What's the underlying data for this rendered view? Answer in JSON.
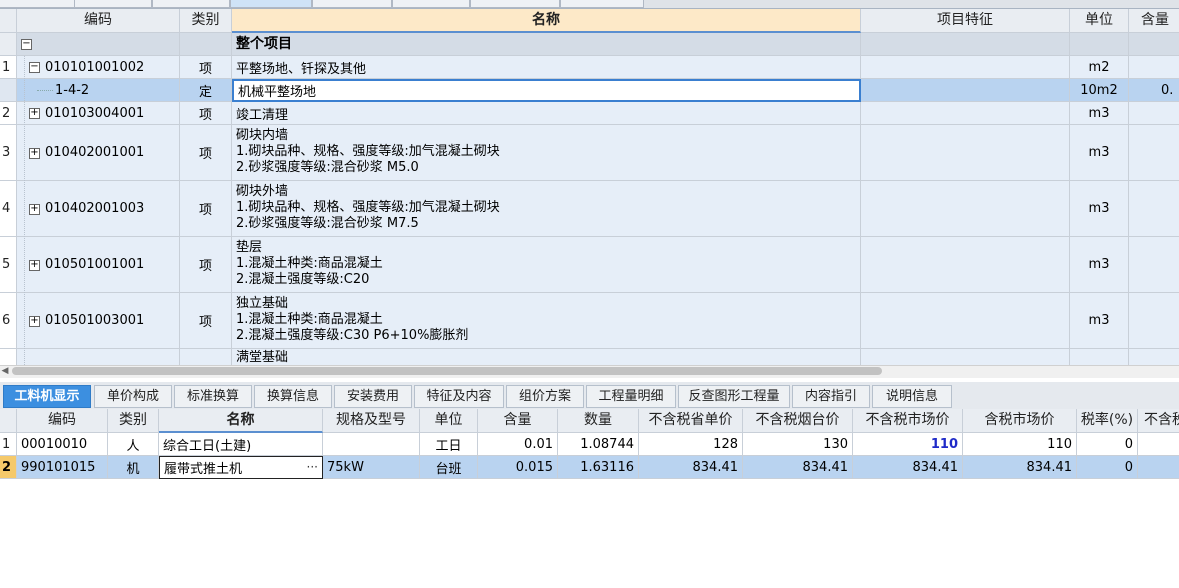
{
  "upper": {
    "headers": {
      "code": "编码",
      "type": "类别",
      "name": "名称",
      "feature": "项目特征",
      "unit": "单位",
      "content": "含量"
    },
    "section": {
      "expander": "−",
      "name": "整个项目"
    },
    "rows": [
      {
        "num": "1",
        "expander": "−",
        "code": "010101001002",
        "type": "项",
        "name_lines": [
          "平整场地、钎探及其他"
        ],
        "unit": "m2",
        "content": ""
      },
      {
        "num": "",
        "expander": "",
        "code": "1-4-2",
        "type": "定",
        "name_lines": [
          "机械平整场地"
        ],
        "unit": "10m2",
        "content": "0."
      },
      {
        "num": "2",
        "expander": "+",
        "code": "010103004001",
        "type": "项",
        "name_lines": [
          "竣工清理"
        ],
        "unit": "m3",
        "content": ""
      },
      {
        "num": "3",
        "expander": "+",
        "code": "010402001001",
        "type": "项",
        "name_lines": [
          "砌块内墙",
          "1.砌块品种、规格、强度等级:加气混凝土砌块",
          "2.砂浆强度等级:混合砂浆 M5.0"
        ],
        "unit": "m3",
        "content": ""
      },
      {
        "num": "4",
        "expander": "+",
        "code": "010402001003",
        "type": "项",
        "name_lines": [
          "砌块外墙",
          "1.砌块品种、规格、强度等级:加气混凝土砌块",
          "2.砂浆强度等级:混合砂浆 M7.5"
        ],
        "unit": "m3",
        "content": ""
      },
      {
        "num": "5",
        "expander": "+",
        "code": "010501001001",
        "type": "项",
        "name_lines": [
          "垫层",
          "1.混凝土种类:商品混凝土",
          "2.混凝土强度等级:C20"
        ],
        "unit": "m3",
        "content": ""
      },
      {
        "num": "6",
        "expander": "+",
        "code": "010501003001",
        "type": "项",
        "name_lines": [
          "独立基础",
          "1.混凝土种类:商品混凝土",
          "2.混凝土强度等级:C30 P6+10%膨胀剂"
        ],
        "unit": "m3",
        "content": ""
      },
      {
        "num": "",
        "expander": "",
        "code": "",
        "type": "",
        "name_lines": [
          "满堂基础"
        ],
        "unit": "",
        "content": ""
      }
    ]
  },
  "scroll": {
    "left_arrow": "◀"
  },
  "bottom_tabs": [
    "工料机显示",
    "单价构成",
    "标准换算",
    "换算信息",
    "安装费用",
    "特征及内容",
    "组价方案",
    "工程量明细",
    "反查图形工程量",
    "内容指引",
    "说明信息"
  ],
  "lower": {
    "headers": [
      "编码",
      "类别",
      "名称",
      "规格及型号",
      "单位",
      "含量",
      "数量",
      "不含税省单价",
      "不含税烟台价",
      "不含税市场价",
      "含税市场价",
      "税率(%)",
      "不含税"
    ],
    "rows": [
      {
        "num": "1",
        "code": "00010010",
        "type": "人",
        "name": "综合工日(土建)",
        "spec": "",
        "unit": "工日",
        "qty_rate": "0.01",
        "quantity": "1.08744",
        "prov_price": "128",
        "yantai_price": "130",
        "market_price": "110",
        "market_tax_price": "110",
        "tax_rate": "0"
      },
      {
        "num": "2",
        "code": "990101015",
        "type": "机",
        "name": "履带式推土机",
        "spec": "75kW",
        "unit": "台班",
        "qty_rate": "0.015",
        "quantity": "1.63116",
        "prov_price": "834.41",
        "yantai_price": "834.41",
        "market_price": "834.41",
        "market_tax_price": "834.41",
        "tax_rate": "0"
      }
    ],
    "ellipsis": "···"
  },
  "colors": {
    "active_tab": "#3c8fe0",
    "selected_row": "#b9d3f0",
    "name_header": "#fde9c8",
    "highlight_value": "#1f2ac8"
  }
}
